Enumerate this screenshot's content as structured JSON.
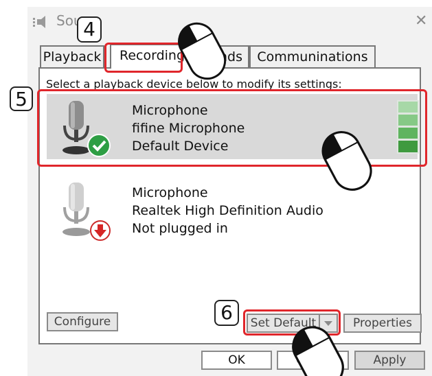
{
  "window": {
    "title": "Sou",
    "close_label": "✕"
  },
  "tabs": [
    {
      "label": "Playback",
      "active": false
    },
    {
      "label": "Recording",
      "active": true
    },
    {
      "label": "nds",
      "active": false
    },
    {
      "label": "Communinations",
      "active": false
    }
  ],
  "instruction": "Select a playback device below to modify its settings:",
  "devices": [
    {
      "lines": [
        "Microphone",
        "fifine Microphone",
        "Default Device"
      ],
      "status_icon": "check-icon",
      "selected": true,
      "level_segments": 4
    },
    {
      "lines": [
        "Microphone",
        "Realtek High Definition Audio",
        "Not plugged in"
      ],
      "status_icon": "down-arrow-icon",
      "selected": false
    }
  ],
  "buttons": {
    "configure": "Configure",
    "set_default": "Set Default",
    "properties": "Properties",
    "ok": "OK",
    "cancel": "Ca",
    "apply": "Apply"
  },
  "callouts": {
    "step4": "4",
    "step5": "5",
    "step6": "6"
  },
  "colors": {
    "highlight": "#e0262b",
    "selected_row": "#d9d9d9",
    "level_green": "#4caf50"
  }
}
